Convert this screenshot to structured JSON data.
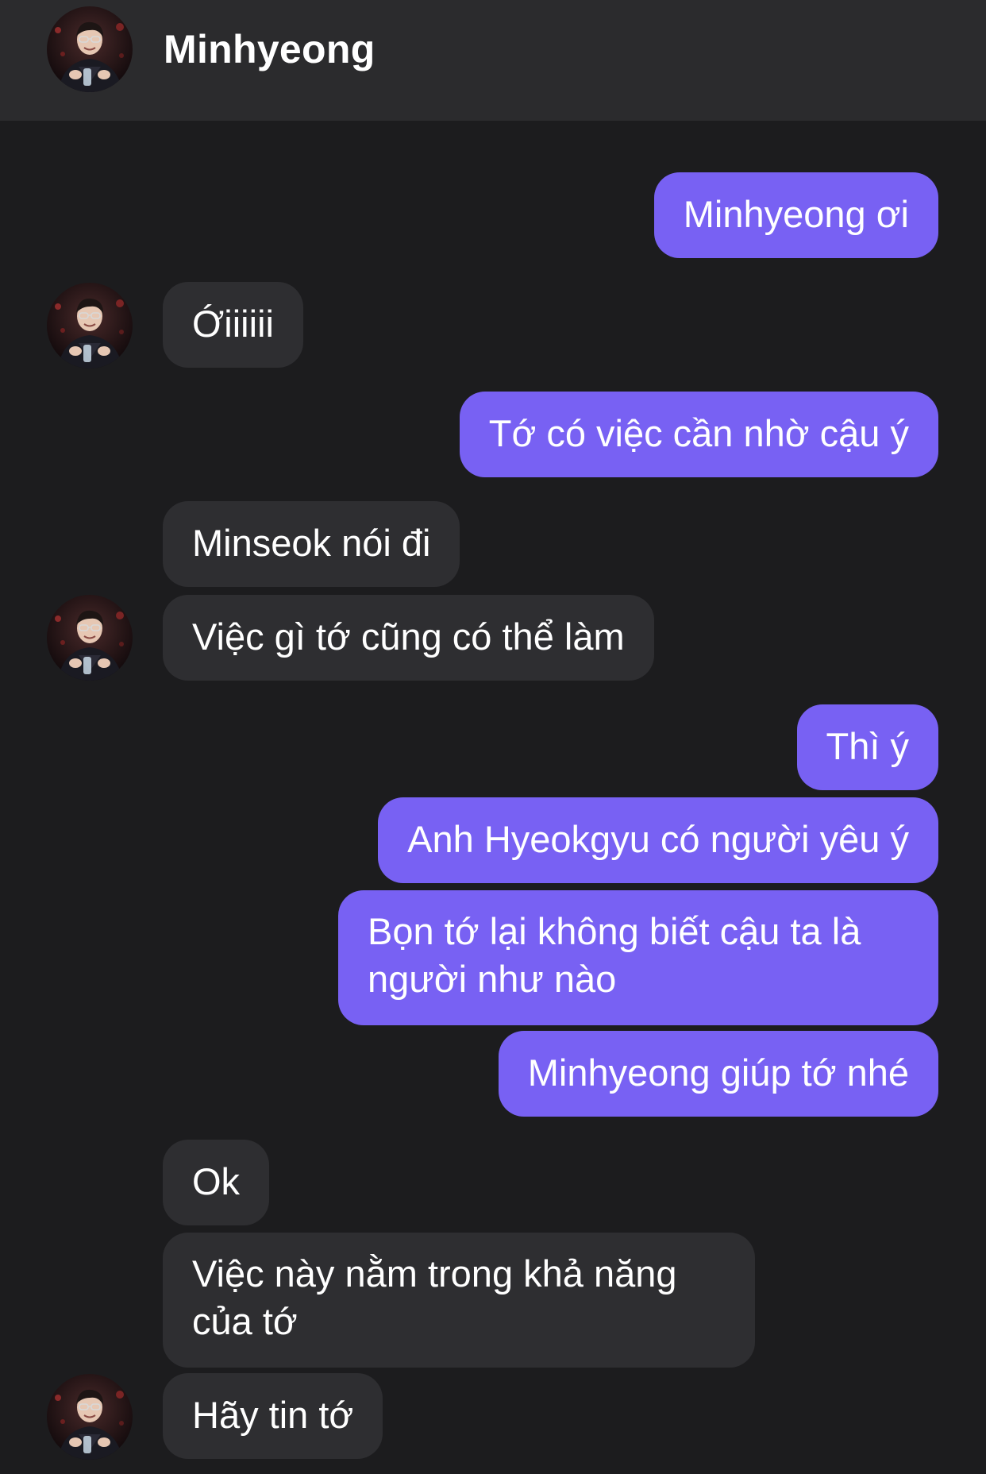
{
  "contact": {
    "name": "Minhyeong",
    "avatar_icon": "contact-avatar-photo"
  },
  "colors": {
    "background": "#1c1c1e",
    "header": "#2b2b2d",
    "outgoing_bubble": "#7861f3",
    "incoming_bubble": "#2e2e31"
  },
  "messages": [
    {
      "side": "outgoing",
      "text": "Minhyeong ơi"
    },
    {
      "side": "incoming",
      "text": "Ớiiiiii",
      "avatar": true
    },
    {
      "side": "outgoing",
      "text": "Tớ có việc cần nhờ cậu ý"
    },
    {
      "side": "incoming",
      "text": "Minseok nói đi"
    },
    {
      "side": "incoming",
      "text": "Việc gì tớ cũng có thể làm",
      "avatar": true
    },
    {
      "side": "outgoing",
      "text": "Thì ý"
    },
    {
      "side": "outgoing",
      "text": "Anh Hyeokgyu có người yêu ý"
    },
    {
      "side": "outgoing",
      "text": "Bọn tớ lại không biết cậu ta là người như nào"
    },
    {
      "side": "outgoing",
      "text": "Minhyeong giúp tớ nhé"
    },
    {
      "side": "incoming",
      "text": "Ok"
    },
    {
      "side": "incoming",
      "text": "Việc này nằm trong khả năng của tớ"
    },
    {
      "side": "incoming",
      "text": "Hãy tin tớ",
      "avatar": true
    }
  ]
}
